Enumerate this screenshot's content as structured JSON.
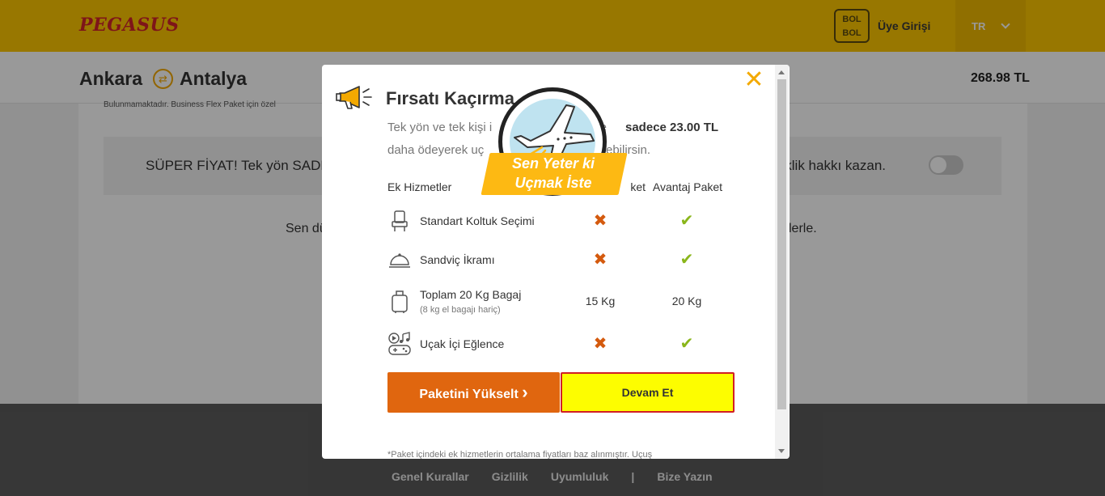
{
  "header": {
    "logo_text": "PEGASUS",
    "bolbol_logo": "BOL BOL",
    "login_label": "Üye Girişi",
    "language": "TR"
  },
  "route": {
    "from": "Ankara",
    "to": "Antalya",
    "price": "268.98 TL",
    "swap_icon": "swap-arrows-icon"
  },
  "page": {
    "small_note": "Bulunmamaktadır. Business Flex Paket için özel",
    "promo_left": "SÜPER FİYAT! Tek yön SADE",
    "promo_right": "şiklik hakkı kazan.",
    "line_left": "Sen dü",
    "line_right": "lerle."
  },
  "modal": {
    "title": "Fırsatı Kaçırma",
    "desc_1": "Tek yön ve tek kişi i",
    "desc_1_tail": "ine",
    "desc_price": "sadece 23.00 TL",
    "desc_2": "daha ödeyerek uç",
    "desc_2_tail": "ebilirsin.",
    "columns": [
      "Ek Hizmetler",
      "ket",
      "Avantaj Paket"
    ],
    "rows": [
      {
        "label": "Standart Koltuk Seçimi",
        "icon": "seat-icon",
        "c1": "✖",
        "c2": "✔"
      },
      {
        "label": "Sandviç İkramı",
        "icon": "food-cloche-icon",
        "c1": "✖",
        "c2": "✔"
      },
      {
        "label": "Toplam 20 Kg Bagaj",
        "sub": "(8 kg el bagajı hariç)",
        "icon": "luggage-icon",
        "c1": "15 Kg",
        "c2": "20 Kg"
      },
      {
        "label": "Uçak İçi Eğlence",
        "icon": "entertainment-icon",
        "c1": "✖",
        "c2": "✔"
      }
    ],
    "upgrade_label": "Paketini Yükselt",
    "upgrade_chevron": "›",
    "continue_label": "Devam Et",
    "footnote": "*Paket içindeki ek hizmetlerin ortalama fiyatları baz alınmıştır. Uçuş",
    "close_glyph": "✕"
  },
  "badge": {
    "line1": "Sen Yeter ki",
    "line2": "Uçmak İste"
  },
  "footer": {
    "links": [
      "Genel Kurallar",
      "Gizlilik",
      "Uyumluluk",
      "|",
      "Bize Yazın"
    ]
  },
  "colors": {
    "brand_yellow": "#fdc600",
    "upgrade_orange": "#e0660f",
    "continue_yellow": "#fdfd00",
    "continue_border": "#d11f25",
    "cross": "#d45a0e",
    "check": "#8ab61b"
  }
}
